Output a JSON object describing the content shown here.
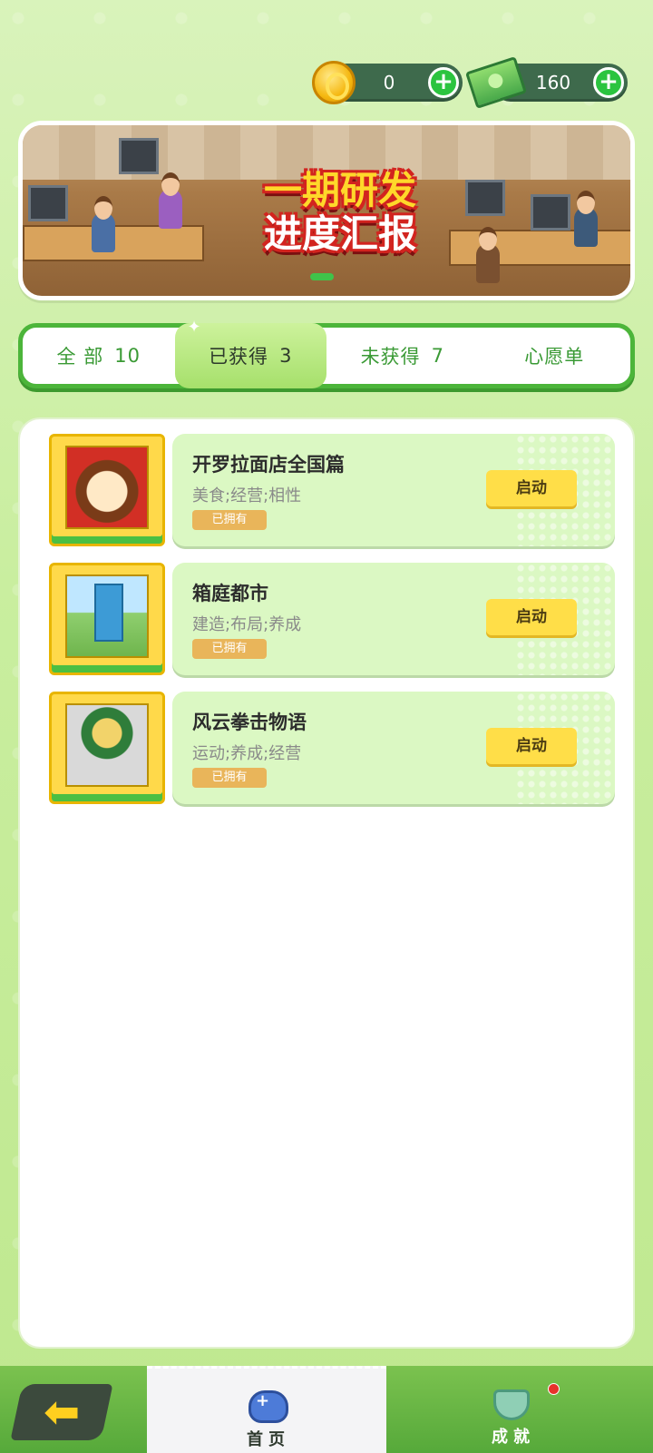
{
  "currency": {
    "coin": {
      "icon": "coin-icon",
      "value": "0"
    },
    "cash": {
      "icon": "cash-icon",
      "value": "160"
    },
    "plus_icon": "+"
  },
  "banner": {
    "title_line1": "一期研发",
    "title_line2": "进度汇报"
  },
  "tabs": [
    {
      "label": "全 部",
      "count": "10"
    },
    {
      "label": "已获得",
      "count": "3",
      "active": true
    },
    {
      "label": "未获得",
      "count": "7"
    },
    {
      "label": "心愿单",
      "count": ""
    }
  ],
  "games": [
    {
      "title": "开罗拉面店全国篇",
      "tags": "美食;经营;相性",
      "badge": "已拥有",
      "button": "启动",
      "icon": "ramen-cartridge-icon"
    },
    {
      "title": "箱庭都市",
      "tags": "建造;布局;养成",
      "badge": "已拥有",
      "button": "启动",
      "icon": "city-cartridge-icon"
    },
    {
      "title": "风云拳击物语",
      "tags": "运动;养成;经营",
      "badge": "已拥有",
      "button": "启动",
      "icon": "boxing-cartridge-icon"
    }
  ],
  "nav": {
    "back_icon": "back-arrow-icon",
    "back_glyph": "⬅",
    "home_label": "首页",
    "achievements_label": "成就",
    "notification_color": "#e8322b"
  },
  "colors": {
    "accent_green": "#4cb53a",
    "launch_yellow": "#ffde48",
    "badge_orange": "#e9b55a"
  }
}
